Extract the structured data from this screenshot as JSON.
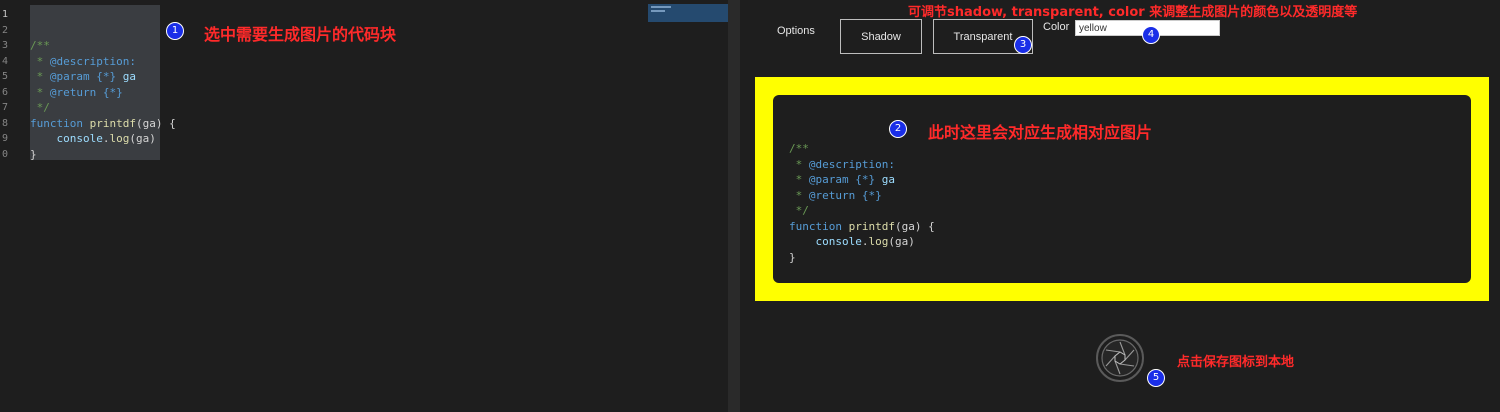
{
  "editor": {
    "line_numbers": [
      "1",
      "2",
      "3",
      "4",
      "5",
      "6",
      "7",
      "8",
      "9",
      "0"
    ],
    "code": {
      "line3": "/**",
      "line4_star": " * ",
      "line4_tag": "@description:",
      "line5_star": " * ",
      "line5_tag": "@param",
      "line5_type": " {*} ",
      "line5_name": "ga",
      "line6_star": " * ",
      "line6_tag": "@return",
      "line6_type": " {*}",
      "line7": " */",
      "line8_kw": "function",
      "line8_fn": " printdf",
      "line8_rest": "(ga) {",
      "line9_indent": "    ",
      "line9_obj": "console",
      "line9_dot": ".",
      "line9_fn": "log",
      "line9_rest": "(ga)",
      "line10": "}"
    }
  },
  "annotations": {
    "a1": "选中需要生成图片的代码块",
    "a2": "此时这里会对应生成相对应图片",
    "a3": "可调节shadow, transparent, color 来调整生成图片的颜色以及透明度等",
    "a5": "点击保存图标到本地"
  },
  "badges": [
    "1",
    "2",
    "3",
    "4",
    "5"
  ],
  "options": {
    "label": "Options",
    "shadow_button": "Shadow",
    "transparent_button": "Transparent",
    "color_label": "Color",
    "color_value": "yellow"
  },
  "preview": {
    "frame_color": "#ffff00",
    "code": {
      "line1": "/**",
      "line2_star": " * ",
      "line2_tag": "@description:",
      "line3_star": " * ",
      "line3_tag": "@param",
      "line3_type": " {*} ",
      "line3_name": "ga",
      "line4_star": " * ",
      "line4_tag": "@return",
      "line4_type": " {*}",
      "line5": " */",
      "line6_kw": "function",
      "line6_fn": " printdf",
      "line6_rest": "(ga) {",
      "line7_indent": "    ",
      "line7_obj": "console",
      "line7_dot": ".",
      "line7_fn": "log",
      "line7_rest": "(ga)",
      "line8": "}"
    }
  },
  "icons": {
    "save": "camera-shutter-icon"
  },
  "colors": {
    "background": "#1e1e1e",
    "annotation": "#ff2a2a",
    "badge": "#1a2ee8",
    "comment": "#6a9955",
    "keyword": "#569cd6",
    "function": "#dcdcaa",
    "variable": "#9cdcfe"
  }
}
